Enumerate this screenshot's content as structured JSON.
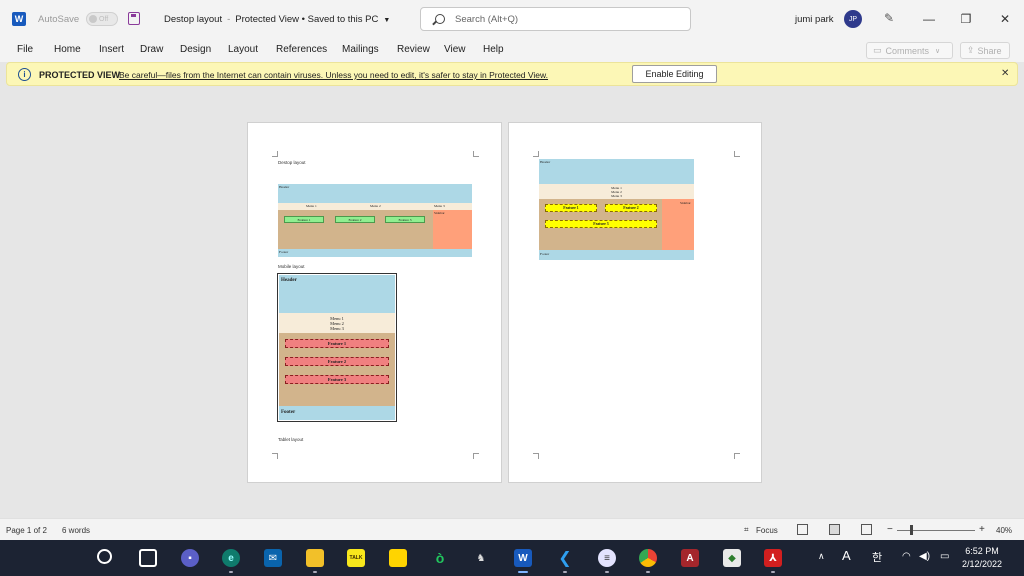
{
  "titlebar": {
    "app_logo": "W",
    "autosave_label": "AutoSave",
    "autosave_state": "Off",
    "document_title": "Destop layout",
    "view_state": "Protected View",
    "save_state": "Saved to this PC",
    "search_placeholder": "Search (Alt+Q)",
    "user_name": "jumi park",
    "user_initials": "JP"
  },
  "ribbon": {
    "tabs": [
      "File",
      "Home",
      "Insert",
      "Draw",
      "Design",
      "Layout",
      "References",
      "Mailings",
      "Review",
      "View",
      "Help"
    ],
    "comments_label": "Comments",
    "share_label": "Share"
  },
  "protected_view": {
    "title": "PROTECTED VIEW",
    "message": "Be careful—files from the Internet can contain viruses. Unless you need to edit, it's safer to stay in Protected View.",
    "button_label": "Enable Editing"
  },
  "page1": {
    "heading": "Destop layout",
    "desktop": {
      "header": "Header",
      "menus": [
        "Menu 1",
        "Menu 2",
        "Menu 3"
      ],
      "sidebar": "Sidebar",
      "features": [
        "Feature 1",
        "Feature 2",
        "Feature 3"
      ],
      "footer": "Footer"
    },
    "mobile_caption": "Mobile layout",
    "mobile": {
      "header": "Header",
      "menus": [
        "Menu 1",
        "Menu 2",
        "Menu 3"
      ],
      "features": [
        "Feature 1",
        "Feature 2",
        "Feature 3"
      ],
      "footer": "Footer"
    },
    "tablet_caption": "Tablet layout"
  },
  "page2": {
    "tablet": {
      "header": "Header",
      "menus": [
        "Menu 1",
        "Menu 2",
        "Menu 3"
      ],
      "sidebar": "Sidebar",
      "features": [
        "Feature 1",
        "Feature 2",
        "Feature 3"
      ],
      "footer": "Footer"
    }
  },
  "statusbar": {
    "page": "Page 1 of 2",
    "words": "6 words",
    "focus_label": "Focus",
    "zoom_minus": "−",
    "zoom_plus": "+",
    "zoom": "40%"
  },
  "taskbar": {
    "kakao_label": "TALK",
    "tray_font": "A",
    "tray_ime": "한",
    "time": "6:52 PM",
    "date": "2/12/2022"
  },
  "colors": {
    "header_bg": "#add8e6",
    "menu_bg": "#f7ecd9",
    "content_bg": "#d2b48c",
    "sidebar_bg": "#ffa07a",
    "word_blue": "#185abd",
    "taskbar_bg": "#1c2333"
  }
}
